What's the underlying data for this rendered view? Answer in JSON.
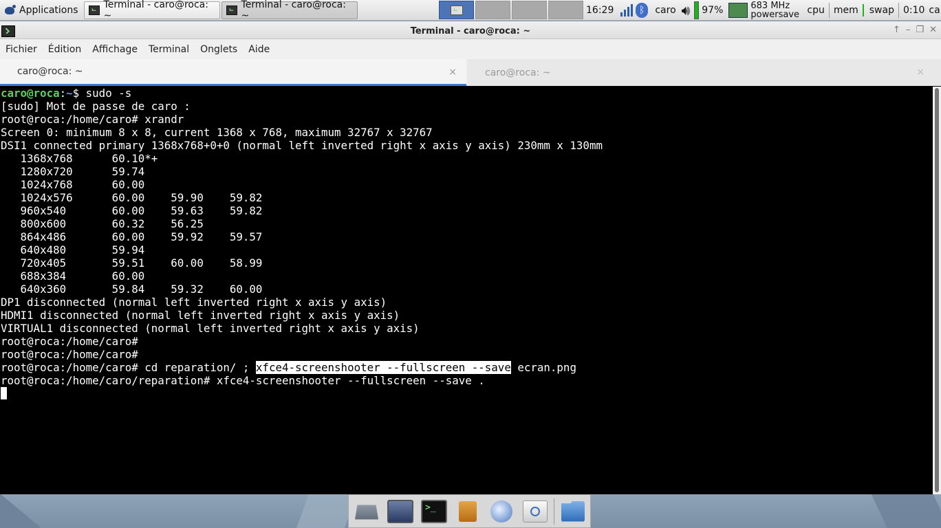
{
  "top_panel": {
    "applications_label": "Applications",
    "tasks": [
      {
        "label": "Terminal - caro@roca: ~"
      },
      {
        "label": "Terminal - caro@roca: ~"
      }
    ],
    "clock": "16:29",
    "bluetooth_glyph": "ᛒ",
    "user_label": "caro",
    "battery_percent": "97%",
    "cpu_freq": "683 MHz",
    "cpu_governor": "powersave",
    "cpu_label": "cpu",
    "mem_label": "mem",
    "swap_label": "swap",
    "uptime": "0:10",
    "user_label_2": "caro",
    "icons": [
      "applications-menu-icon",
      "terminal-icon",
      "signal-icon",
      "bluetooth-icon",
      "volume-icon",
      "battery-icon",
      "cpu-freq-icon"
    ]
  },
  "window": {
    "title": "Terminal - caro@roca: ~",
    "menu": [
      "Fichier",
      "Édition",
      "Affichage",
      "Terminal",
      "Onglets",
      "Aide"
    ],
    "tabs": [
      {
        "label": "caro@roca: ~",
        "close": "×"
      },
      {
        "label": "caro@roca: ~",
        "close": "×"
      }
    ],
    "controls": [
      "↑",
      "–",
      "❐",
      "✕"
    ]
  },
  "terminal": {
    "prompt_user": "caro@roca",
    "prompt_sep": ":",
    "prompt_path": "~",
    "first_command": "$ sudo -s",
    "lines": [
      "[sudo] Mot de passe de caro :",
      "root@roca:/home/caro# xrandr",
      "Screen 0: minimum 8 x 8, current 1368 x 768, maximum 32767 x 32767",
      "DSI1 connected primary 1368x768+0+0 (normal left inverted right x axis y axis) 230mm x 130mm",
      "   1368x768      60.10*+",
      "   1280x720      59.74",
      "   1024x768      60.00",
      "   1024x576      60.00    59.90    59.82",
      "   960x540       60.00    59.63    59.82",
      "   800x600       60.32    56.25",
      "   864x486       60.00    59.92    59.57",
      "   640x480       59.94",
      "   720x405       59.51    60.00    58.99",
      "   688x384       60.00",
      "   640x360       59.84    59.32    60.00",
      "DP1 disconnected (normal left inverted right x axis y axis)",
      "HDMI1 disconnected (normal left inverted right x axis y axis)",
      "VIRTUAL1 disconnected (normal left inverted right x axis y axis)",
      "root@roca:/home/caro#",
      "root@roca:/home/caro#"
    ],
    "cd_line_prefix": "root@roca:/home/caro# cd reparation/ ; ",
    "cd_line_selected": "xfce4-screenshooter --fullscreen --save",
    "cd_line_suffix": " ecran.png",
    "last_line": "root@roca:/home/caro/reparation# xfce4-screenshooter --fullscreen --save ."
  },
  "dock": {
    "items": [
      "trash-icon",
      "display-icon",
      "terminal-icon",
      "archive-icon",
      "web-browser-icon",
      "search-icon",
      "folder-icon"
    ]
  }
}
